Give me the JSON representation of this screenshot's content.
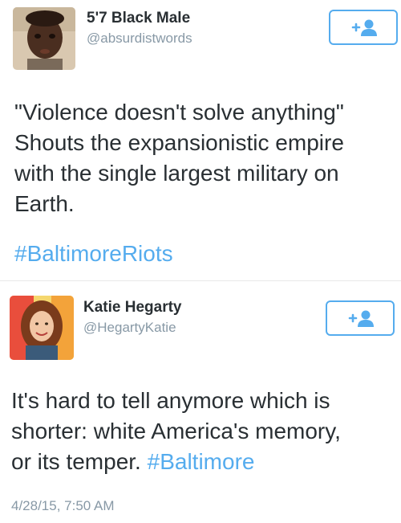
{
  "tweets": [
    {
      "name": "5'7 Black Male",
      "handle": "@absurdistwords",
      "avatar": "child-portrait-avatar",
      "text_lines": [
        "\"Violence doesn't solve anything\"",
        "Shouts the expansionistic empire",
        "with the single largest military on",
        "Earth."
      ],
      "hashtag": "#BaltimoreRiots",
      "follow_icon": "follow-plus-person-icon"
    },
    {
      "name": "Katie Hegarty",
      "handle": "@HegartyKatie",
      "avatar": "woman-portrait-avatar",
      "text_lines": [
        "It's hard to tell anymore which is",
        "shorter: white America's memory,",
        "or its temper."
      ],
      "hashtag": "#Baltimore",
      "timestamp": "4/28/15, 7:50 AM",
      "follow_icon": "follow-plus-person-icon"
    }
  ],
  "colors": {
    "accent": "#55acee",
    "secondary_text": "#8899a6",
    "primary_text": "#292f33"
  }
}
